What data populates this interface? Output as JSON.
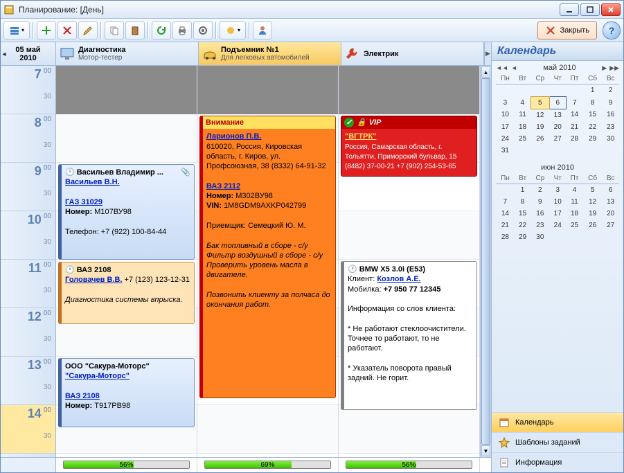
{
  "window": {
    "title": "Планирование: [День]"
  },
  "toolbar": {
    "close_label": "Закрыть"
  },
  "date_header": {
    "line1": "05 май",
    "line2": "2010"
  },
  "columns": [
    {
      "title": "Диагностика",
      "subtitle": "Мотор-тестер",
      "warn": false
    },
    {
      "title": "Подъемник №1",
      "subtitle": "Для легковых автомобилей",
      "warn": true
    },
    {
      "title": "Электрик",
      "subtitle": "",
      "warn": false
    }
  ],
  "hours": [
    "7",
    "8",
    "9",
    "10",
    "11",
    "12",
    "13",
    "14"
  ],
  "minute_label_00": "00",
  "minute_label_30": "30",
  "appts": {
    "a1": {
      "header": "Васильев Владимир ...",
      "link": "Васильев В.Н.",
      "car": "ГАЗ 31029",
      "num_lbl": "Номер:",
      "num": "М107ВУ98",
      "phone": "Телефон: +7 (922) 100-84-44"
    },
    "a2": {
      "header": "ВАЗ 2108",
      "link": "Головачев В.В.",
      "link_suffix": "+7 (123) 123-12-31",
      "desc": "Диагностика системы впрыска."
    },
    "a3": {
      "header": "ООО \"Сакура-Моторс\"",
      "link": "\"Сакура-Моторс\"",
      "car": "ВАЗ 2108",
      "num_lbl": "Номер:",
      "num": "Т917РВ98"
    },
    "b1": {
      "title": "Внимание",
      "link": "Ларионов П.В.",
      "addr": "610020, Россия, Кировская область, г. Киров, ул. Профсоюзная, 38 (8332) 64-91-32",
      "car": "ВАЗ 2112",
      "num_lbl": "Номер:",
      "num": "М302ВУ98",
      "vin_lbl": "VIN:",
      "vin": "1M8GDM9AXKP042799",
      "recv": "Приемщик: Семецкий Ю. М.",
      "w1": "Бак топливный в сборе - с/у",
      "w2": "Фильтр воздушный в сборе - с/у",
      "w3": "Проверить уровень масла в двигателе.",
      "note": "Позвонить клиенту за полчаса до окончания работ."
    },
    "c1": {
      "title_icon1": "check",
      "title_icon2": "lock",
      "title": "VIP",
      "link": "\"ВГТРК\"",
      "addr": "Россия, Самарская область, г. Тольятти, Приморский бульвар, 15 (8482) 37-00-21 +7 (902) 254-53-65"
    },
    "c2": {
      "header": "BMW X5 3.0i (E53)",
      "client_lbl": "Клиент:",
      "client_link": "Козлов А.Е.",
      "phone_lbl": "Мобилка:",
      "phone": "+7 950 77 12345",
      "info_h": "Информация со слов клиента:",
      "info1": "* Не работают стеклоочистители. Точнее то работают, то не работают.",
      "info2": "* Указатель поворота правый задний. Не горит."
    }
  },
  "progress": {
    "c0": "56%",
    "c1": "69%",
    "c2": "56%"
  },
  "side": {
    "title": "Календарь",
    "cal1": {
      "label": "май 2010"
    },
    "cal2": {
      "label": "июн 2010"
    },
    "items": {
      "calendar": "Календарь",
      "templates": "Шаблоны заданий",
      "info": "Информация"
    },
    "dow": [
      "Пн",
      "Вт",
      "Ср",
      "Чт",
      "Пт",
      "Сб",
      "Вс"
    ]
  }
}
